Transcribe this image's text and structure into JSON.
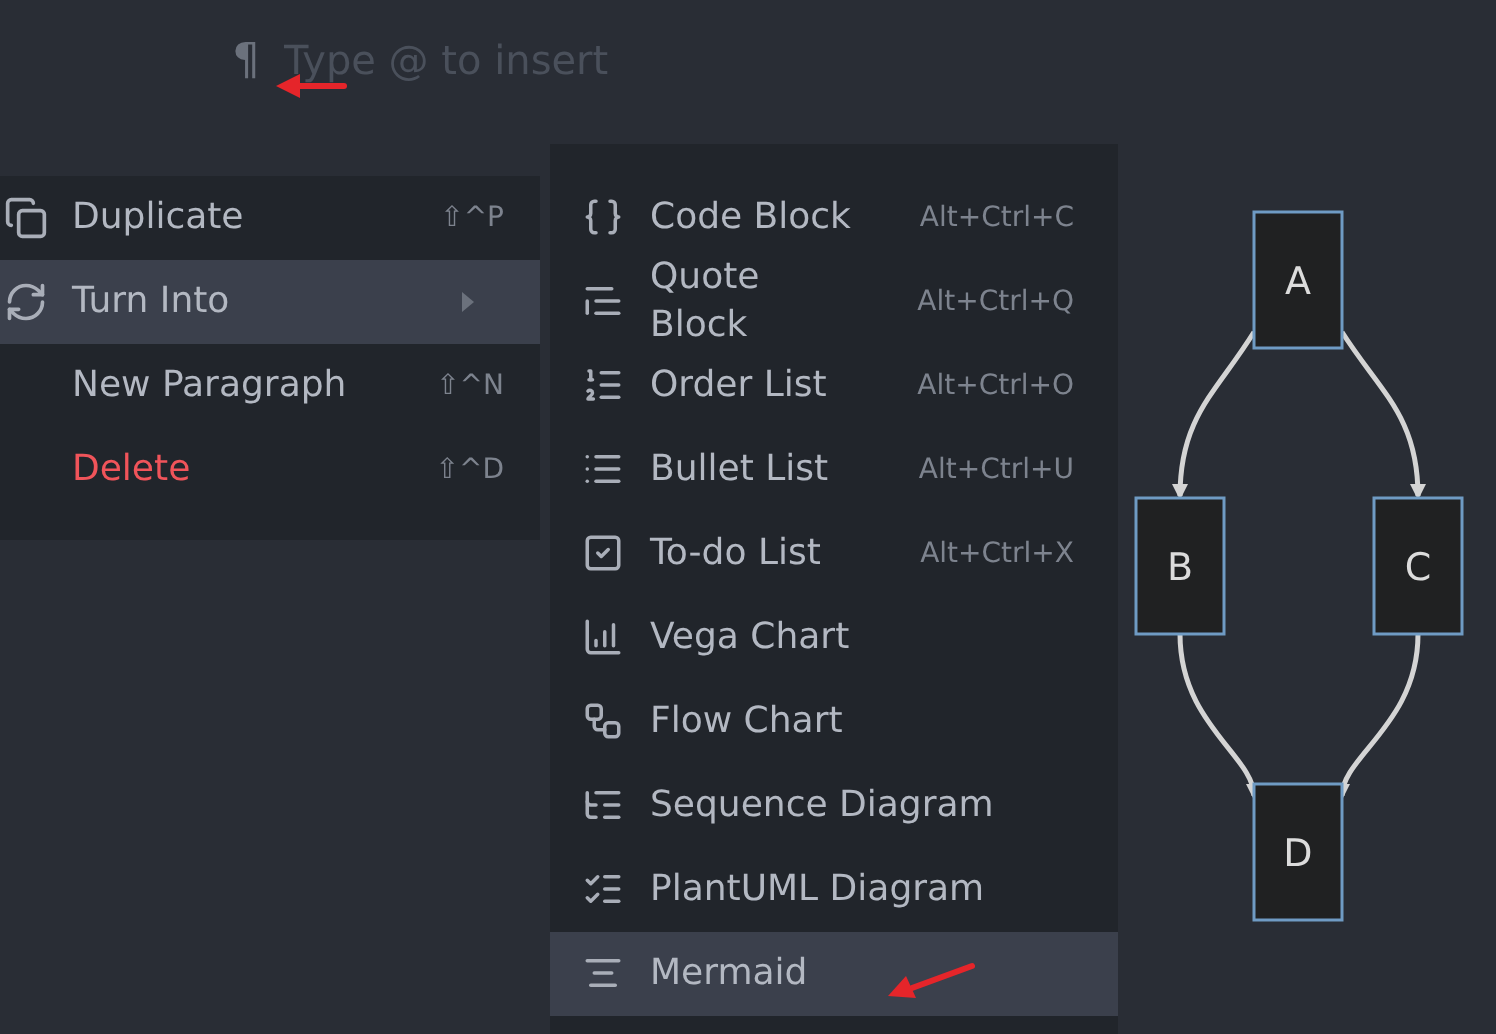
{
  "editor": {
    "paragraph_mark": "¶",
    "placeholder": "Type @ to insert"
  },
  "block_menu": {
    "items": [
      {
        "label": "Duplicate",
        "shortcut": "⇧^P",
        "kind": "normal",
        "selected": false,
        "has_submenu": false
      },
      {
        "label": "Turn Into",
        "kind": "normal",
        "selected": true,
        "has_submenu": true
      },
      {
        "label": "New Paragraph",
        "shortcut": "⇧^N",
        "kind": "normal",
        "selected": false,
        "has_submenu": false
      },
      {
        "label": "Delete",
        "shortcut": "⇧^D",
        "kind": "danger",
        "selected": false,
        "has_submenu": false
      }
    ]
  },
  "turn_into_menu": {
    "items": [
      {
        "label": "Code Block",
        "shortcut": "Alt+Ctrl+C",
        "selected": false
      },
      {
        "label": "Quote Block",
        "shortcut": "Alt+Ctrl+Q",
        "selected": false
      },
      {
        "label": "Order List",
        "shortcut": "Alt+Ctrl+O",
        "selected": false
      },
      {
        "label": "Bullet List",
        "shortcut": "Alt+Ctrl+U",
        "selected": false
      },
      {
        "label": "To-do List",
        "shortcut": "Alt+Ctrl+X",
        "selected": false
      },
      {
        "label": "Vega Chart",
        "selected": false
      },
      {
        "label": "Flow Chart",
        "selected": false
      },
      {
        "label": "Sequence Diagram",
        "selected": false
      },
      {
        "label": "PlantUML Diagram",
        "selected": false
      },
      {
        "label": "Mermaid",
        "selected": true
      }
    ]
  },
  "diagram": {
    "nodes": [
      {
        "label": "A"
      },
      {
        "label": "B"
      },
      {
        "label": "C"
      },
      {
        "label": "D"
      }
    ]
  }
}
